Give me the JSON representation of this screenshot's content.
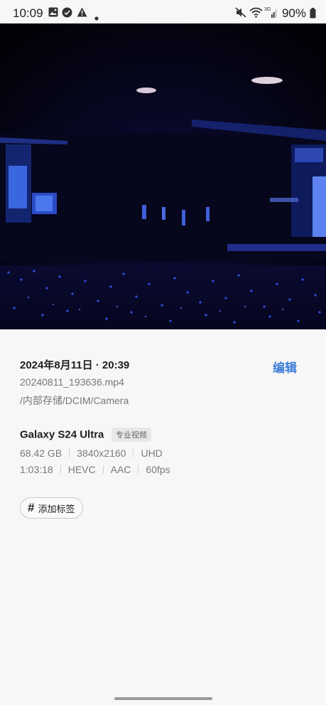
{
  "status_bar": {
    "time": "10:09",
    "battery": "90%",
    "network": "3G",
    "icons": [
      "gallery-icon",
      "app-icon",
      "alert-icon",
      "dot-icon",
      "mute-icon",
      "wifi-icon",
      "signal-icon",
      "battery-icon"
    ]
  },
  "media": {
    "kind": "video",
    "description_icon": "concert-video-thumbnail"
  },
  "info": {
    "datetime": "2024年8月11日 · 20:39",
    "edit_label": "编辑",
    "file_name": "20240811_193636.mp4",
    "path": "/内部存储/DCIM/Camera"
  },
  "device": {
    "name": "Galaxy S24 Ultra",
    "mode_badge": "专业视频"
  },
  "specs": {
    "size": "68.42 GB",
    "resolution": "3840x2160",
    "quality": "UHD",
    "duration": "1:03:18",
    "codec": "HEVC",
    "audio": "AAC",
    "fps": "60fps"
  },
  "tag_button": {
    "icon": "#",
    "label": "添加标签"
  },
  "colors": {
    "accent": "#3b7dd8",
    "background": "#f7f7f7"
  }
}
